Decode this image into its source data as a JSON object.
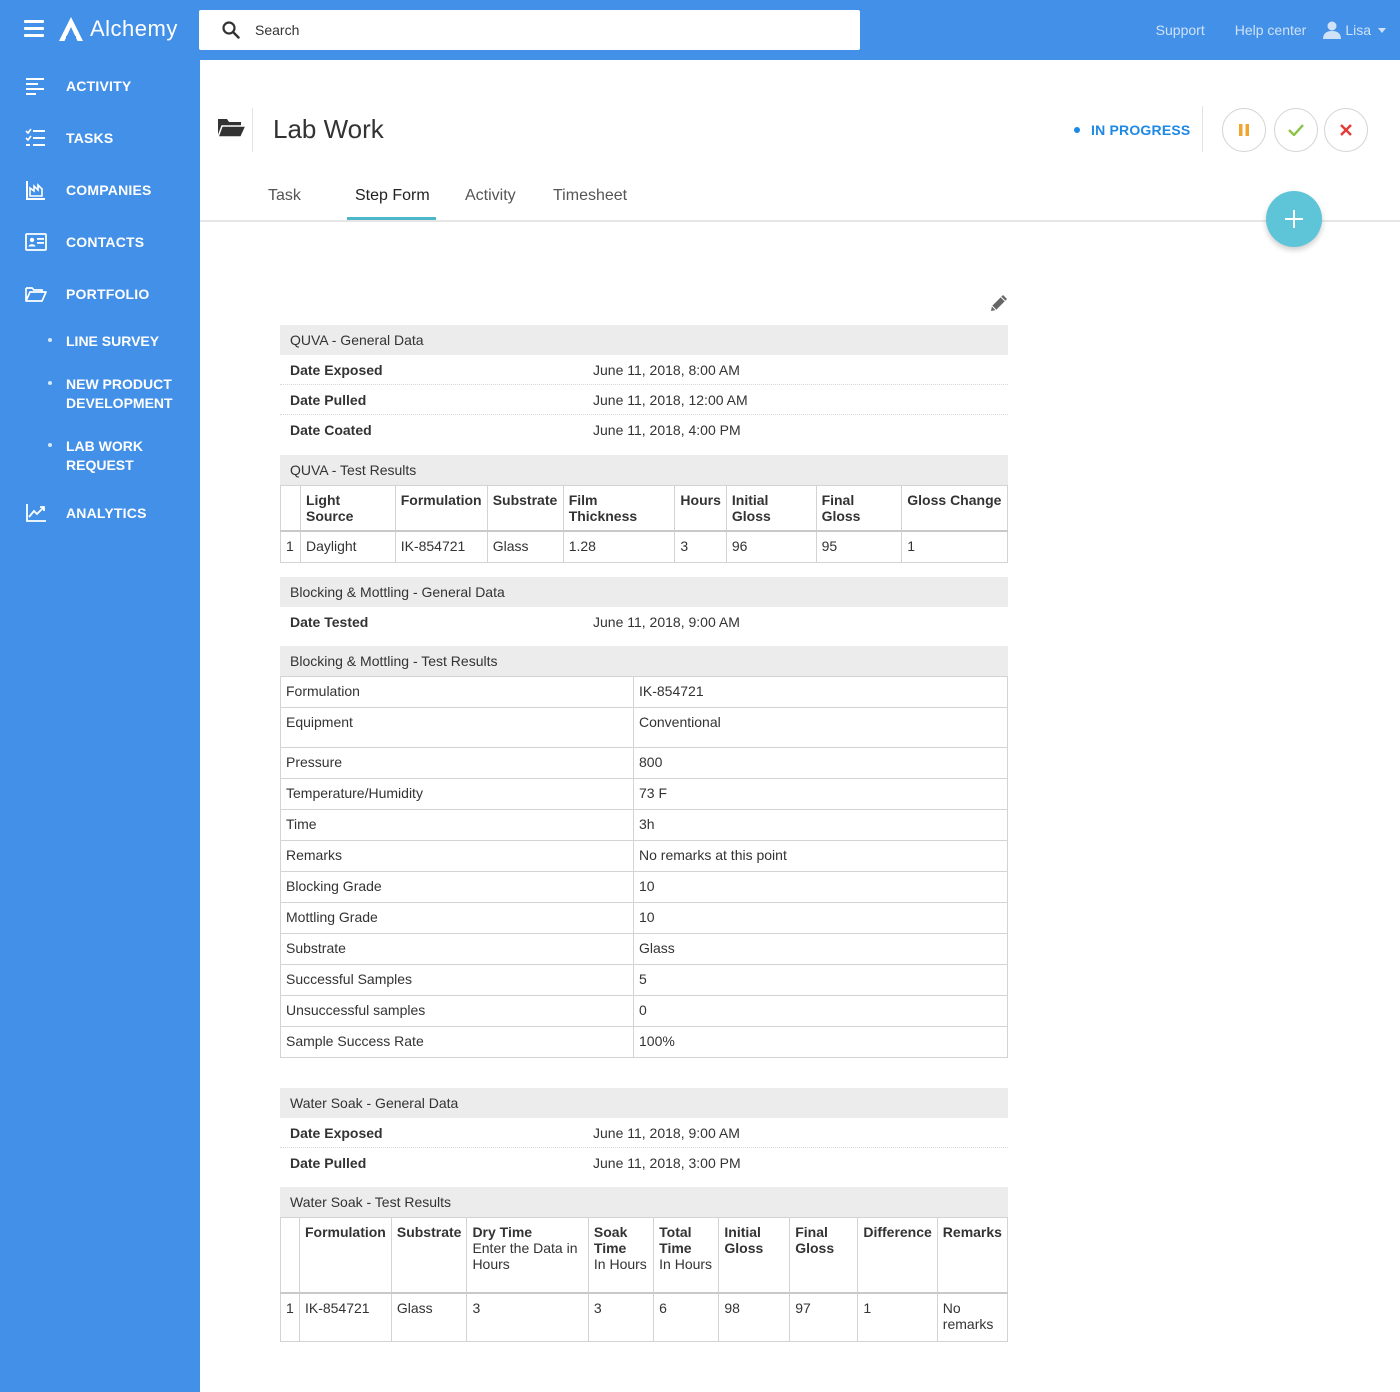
{
  "app": {
    "name": "Alchemy"
  },
  "colors": {
    "brand": "#4390e8",
    "accent": "#5ec4d8",
    "status": "#1e88e5",
    "pause": "#f0a62c",
    "check": "#8bc34a",
    "cancel": "#e53935"
  },
  "search": {
    "placeholder": "Search"
  },
  "top_links": {
    "support": "Support",
    "help": "Help center",
    "user": "Lisa"
  },
  "sidebar": {
    "items": [
      {
        "label": "ACTIVITY",
        "icon": "activity-icon"
      },
      {
        "label": "TASKS",
        "icon": "tasks-icon"
      },
      {
        "label": "COMPANIES",
        "icon": "companies-icon"
      },
      {
        "label": "CONTACTS",
        "icon": "contacts-icon"
      },
      {
        "label": "PORTFOLIO",
        "icon": "folder-open-icon"
      }
    ],
    "sub_items": [
      {
        "label": "LINE SURVEY"
      },
      {
        "label": "NEW PRODUCT DEVELOPMENT"
      },
      {
        "label": "LAB WORK REQUEST"
      }
    ],
    "analytics": {
      "label": "ANALYTICS",
      "icon": "analytics-icon"
    }
  },
  "header": {
    "title": "Lab Work",
    "status": "IN PROGRESS"
  },
  "tabs": [
    {
      "label": "Task"
    },
    {
      "label": "Step Form"
    },
    {
      "label": "Activity"
    },
    {
      "label": "Timesheet"
    }
  ],
  "quva_general": {
    "title": "QUVA - General Data",
    "rows": [
      {
        "k": "Date Exposed",
        "v": "June 11, 2018, 8:00 AM"
      },
      {
        "k": "Date Pulled",
        "v": "June 11, 2018, 12:00 AM"
      },
      {
        "k": "Date Coated",
        "v": "June 11, 2018, 4:00 PM"
      }
    ]
  },
  "quva_results": {
    "title": "QUVA - Test Results",
    "headers": [
      "Light Source",
      "Formulation",
      "Substrate",
      "Film Thickness",
      "Hours",
      "Initial Gloss",
      "Final Gloss",
      "Gloss Change"
    ],
    "rows": [
      [
        "1",
        "Daylight",
        "IK-854721",
        "Glass",
        "1.28",
        "3",
        "96",
        "95",
        "1"
      ]
    ]
  },
  "blocking_general": {
    "title": "Blocking & Mottling - General Data",
    "rows": [
      {
        "k": "Date Tested",
        "v": "June 11, 2018, 9:00 AM"
      }
    ]
  },
  "blocking_results": {
    "title": "Blocking & Mottling - Test Results",
    "rows": [
      {
        "k": "Formulation",
        "v": "IK-854721"
      },
      {
        "k": "Equipment",
        "v": "Conventional"
      },
      {
        "k": "Pressure",
        "v": "800"
      },
      {
        "k": "Temperature/Humidity",
        "v": "73 F"
      },
      {
        "k": "Time",
        "v": "3h"
      },
      {
        "k": "Remarks",
        "v": "No remarks at this point"
      },
      {
        "k": "Blocking Grade",
        "v": "10"
      },
      {
        "k": "Mottling Grade",
        "v": "10"
      },
      {
        "k": "Substrate",
        "v": "Glass"
      },
      {
        "k": "Successful Samples",
        "v": "5"
      },
      {
        "k": "Unsuccessful samples",
        "v": "0"
      },
      {
        "k": "Sample Success Rate",
        "v": "100%"
      }
    ]
  },
  "water_general": {
    "title": "Water Soak - General Data",
    "rows": [
      {
        "k": "Date Exposed",
        "v": "June 11, 2018, 9:00 AM"
      },
      {
        "k": "Date Pulled",
        "v": "June 11, 2018, 3:00 PM"
      }
    ]
  },
  "water_results": {
    "title": "Water Soak - Test Results",
    "headers": [
      {
        "title": "Formulation",
        "sub": ""
      },
      {
        "title": "Substrate",
        "sub": ""
      },
      {
        "title": "Dry Time",
        "sub": "Enter the Data in Hours"
      },
      {
        "title": "Soak Time",
        "sub": "In Hours"
      },
      {
        "title": "Total Time",
        "sub": "In Hours"
      },
      {
        "title": "Initial Gloss",
        "sub": ""
      },
      {
        "title": "Final Gloss",
        "sub": ""
      },
      {
        "title": "Difference",
        "sub": ""
      },
      {
        "title": "Remarks",
        "sub": ""
      }
    ],
    "rows": [
      [
        "1",
        "IK-854721",
        "Glass",
        "3",
        "3",
        "6",
        "98",
        "97",
        "1",
        "No remarks"
      ]
    ]
  }
}
